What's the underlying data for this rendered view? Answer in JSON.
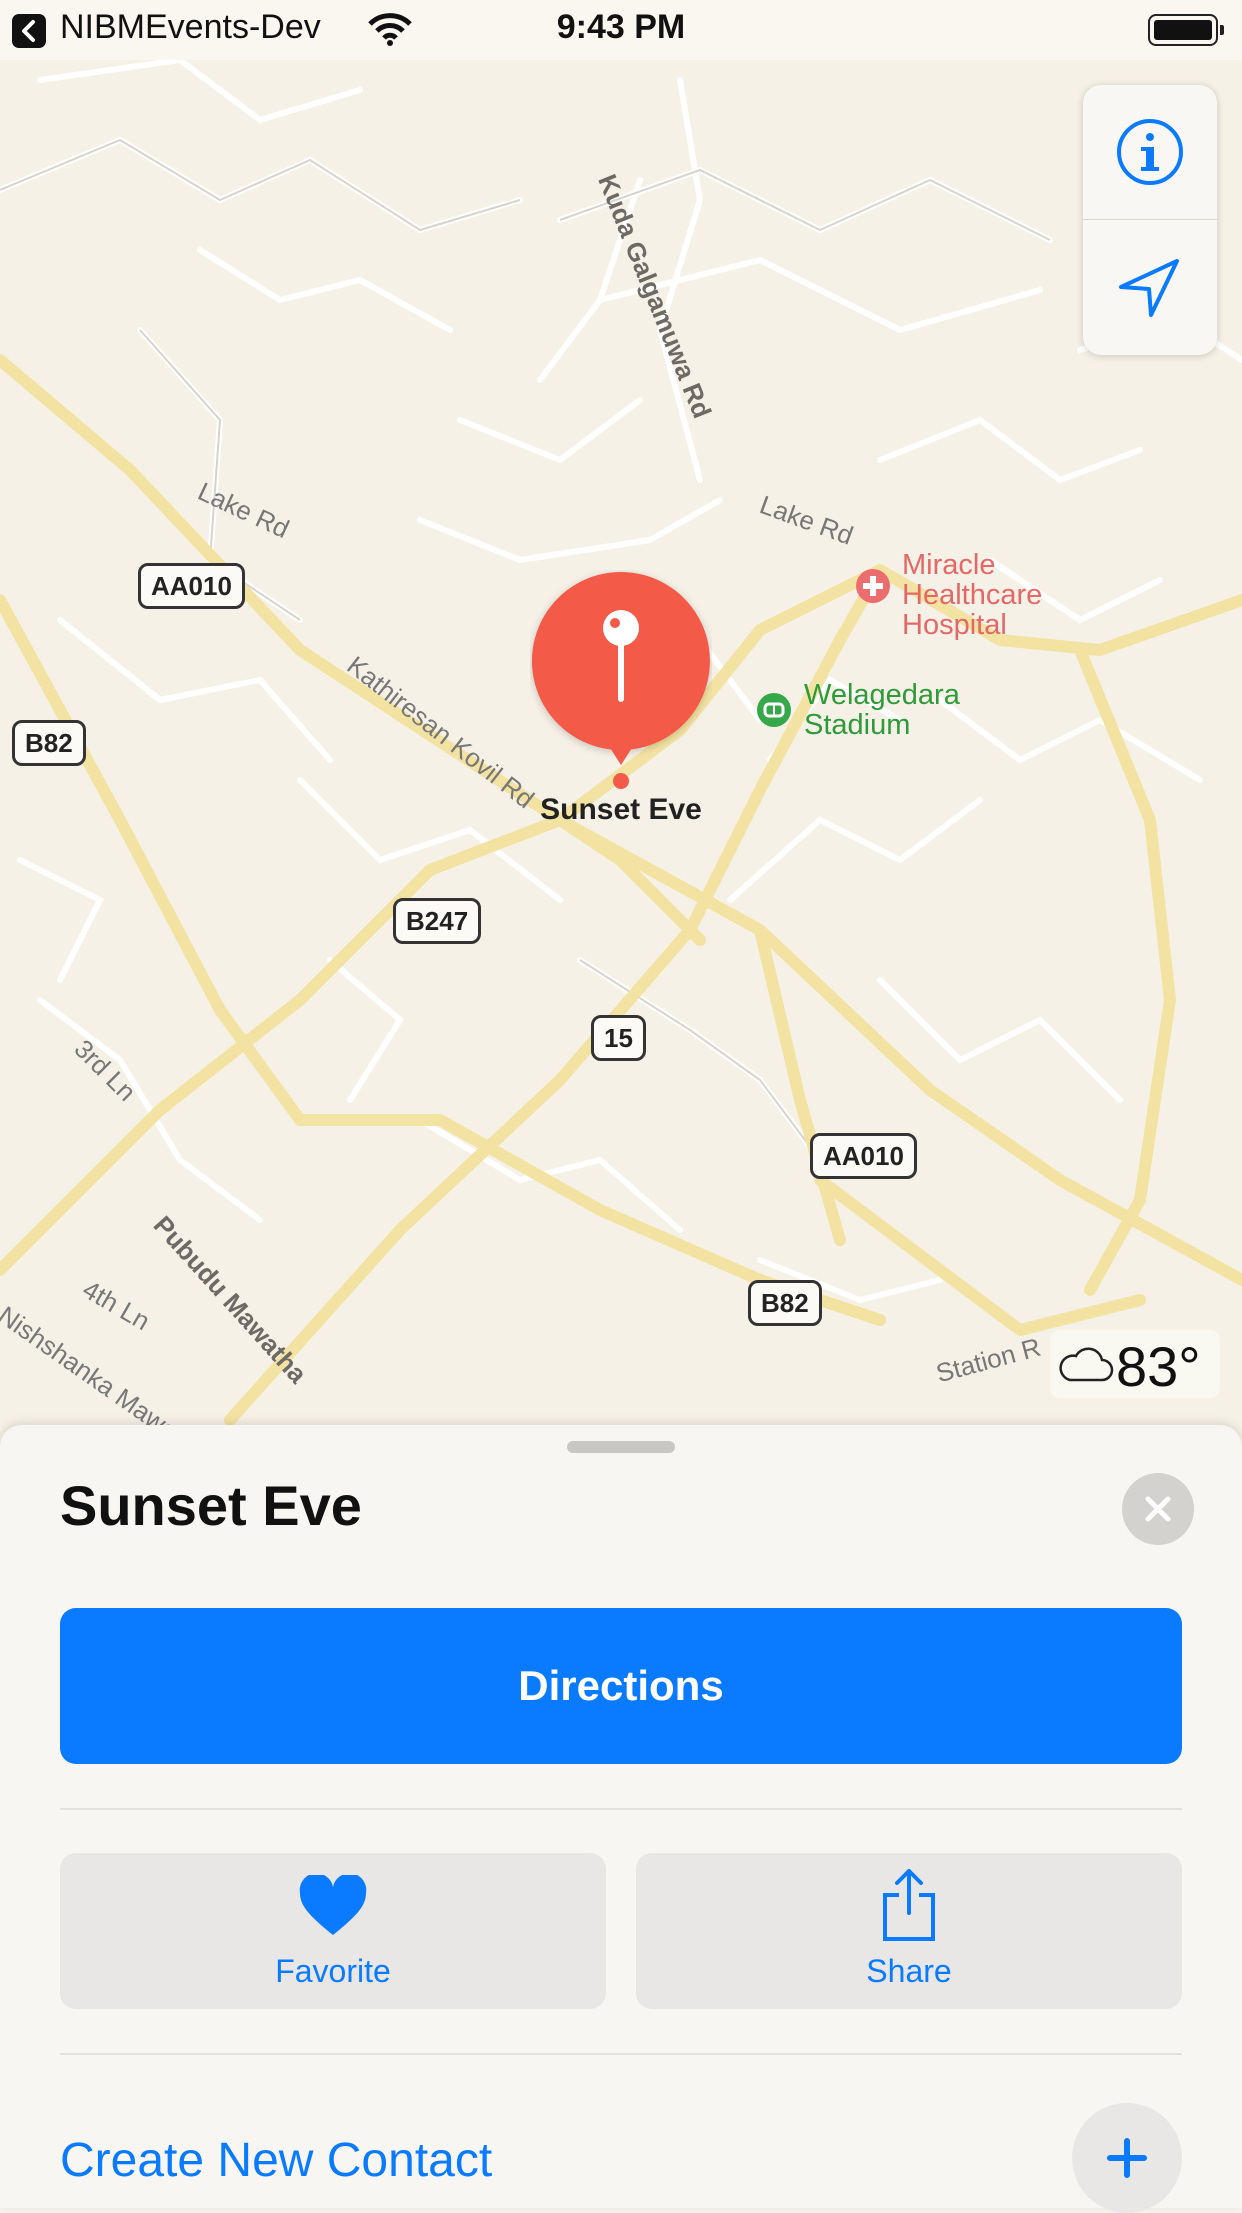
{
  "status_bar": {
    "back_app": "NIBMEvents-Dev",
    "time": "9:43 PM"
  },
  "map": {
    "road_names": [
      "Kuda Galgamuwa Rd",
      "Lake Rd",
      "Lake Rd",
      "Kathiresan Kovil Rd",
      "3rd Ln",
      "Pubudu Mawatha",
      "4th Ln",
      "Nishshanka Mawa",
      "Station R"
    ],
    "shields": [
      "AA010",
      "B82",
      "B247",
      "15",
      "AA010",
      "B82"
    ],
    "poi_hospital": [
      "Miracle",
      "Healthcare",
      "Hospital"
    ],
    "poi_stadium": [
      "Welagedara",
      "Stadium"
    ],
    "pin_label": "Sunset Eve",
    "weather_temp": "83°"
  },
  "sheet": {
    "title": "Sunset Eve",
    "directions_label": "Directions",
    "favorite_label": "Favorite",
    "share_label": "Share",
    "create_contact_label": "Create New Contact"
  },
  "colors": {
    "accent": "#0a7bff",
    "pin": "#f35a47",
    "map_bg": "#f6f1e6"
  },
  "icons": [
    "back-arrow-icon",
    "wifi-icon",
    "battery-icon",
    "info-icon",
    "location-arrow-icon",
    "cloud-icon",
    "close-icon",
    "heart-icon",
    "share-icon",
    "plus-icon"
  ]
}
